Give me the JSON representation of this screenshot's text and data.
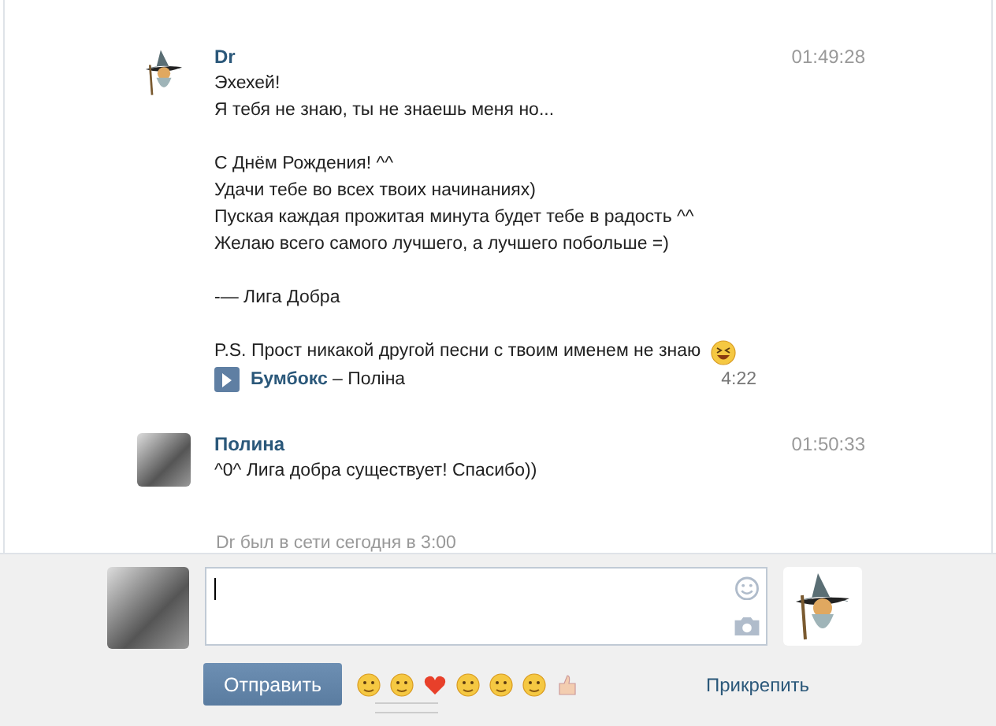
{
  "messages": [
    {
      "sender": "Dr",
      "kind": "wizard",
      "time": "01:49:28",
      "paragraphs": [
        "Эхехей!\nЯ тебя не знаю, ты не знаешь меня но...",
        "С Днём Рождения! ^^\nУдачи тебе во всех твоих начинаниях)\nПуская каждая прожитая минута будет тебе в радость ^^\nЖелаю всего самого лучшего, а лучшего побольше =)",
        "-— Лига Добра",
        "P.S. Прост никакой другой песни с твоим именем не знаю"
      ],
      "ends_with_emoji": true,
      "audio": {
        "artist": "Бумбокс",
        "separator": "–",
        "title": "Поліна",
        "duration": "4:22"
      }
    },
    {
      "sender": "Полина",
      "kind": "photo",
      "time": "01:50:33",
      "paragraphs": [
        "^0^ Лига добра существует! Спасибо))"
      ],
      "ends_with_emoji": false
    }
  ],
  "status": "Dr был в сети сегодня в 3:00",
  "composer": {
    "send_button": "Отправить",
    "attach_link": "Прикрепить"
  }
}
